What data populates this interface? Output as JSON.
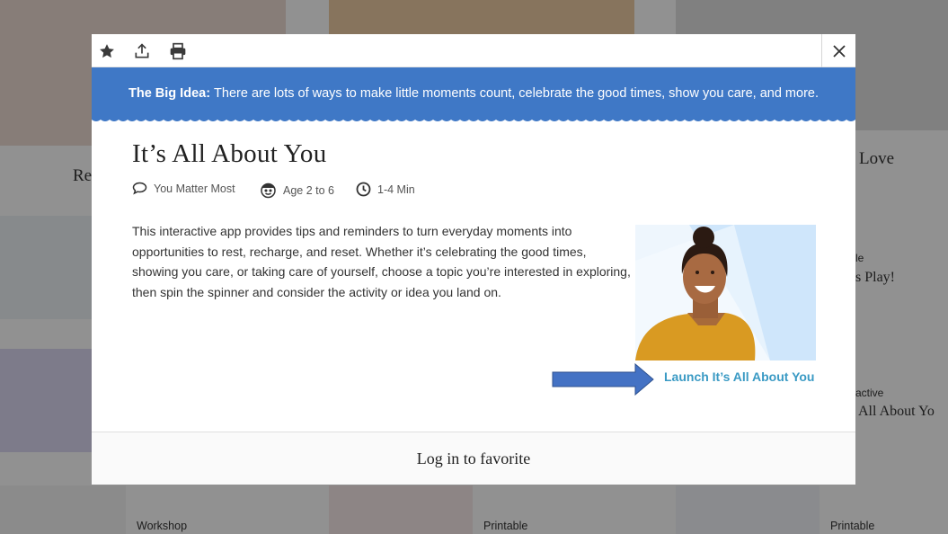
{
  "background": {
    "left_title_fragment": "Re",
    "right_title_fragment": "Love",
    "right_label_1": "le",
    "right_title_2": "s Play!",
    "right_label_3": "active",
    "right_title_3": "All About Yo",
    "bottom_labels": [
      "Workshop",
      "Printable",
      "Printable"
    ]
  },
  "toolbar": {
    "favorite_icon": "star-icon",
    "share_icon": "share-icon",
    "print_icon": "print-icon",
    "close_icon": "close-icon"
  },
  "banner": {
    "label": "The Big Idea:",
    "text": "There are lots of ways to make little moments count, celebrate the good times, show you care, and more."
  },
  "content": {
    "title": "It’s All About You",
    "meta": [
      {
        "icon": "speech-bubble-icon",
        "text": "You Matter Most"
      },
      {
        "icon": "child-face-icon",
        "text": "Age 2 to 6"
      },
      {
        "icon": "clock-icon",
        "text": "1-4 Min"
      }
    ],
    "description": "This interactive app provides tips and reminders to turn everyday moments into opportunities to rest, recharge, and reset. Whether it’s celebrating the good times, showing you care, or taking care of yourself, choose a topic you’re interested in exploring, then spin the spinner and consider the activity or idea you land on.",
    "launch_label": "Launch It’s All About You"
  },
  "footer": {
    "login_label": "Log in to favorite"
  },
  "colors": {
    "banner": "#3f78c6",
    "link": "#3a9ac4",
    "arrow": "#4472c4"
  }
}
